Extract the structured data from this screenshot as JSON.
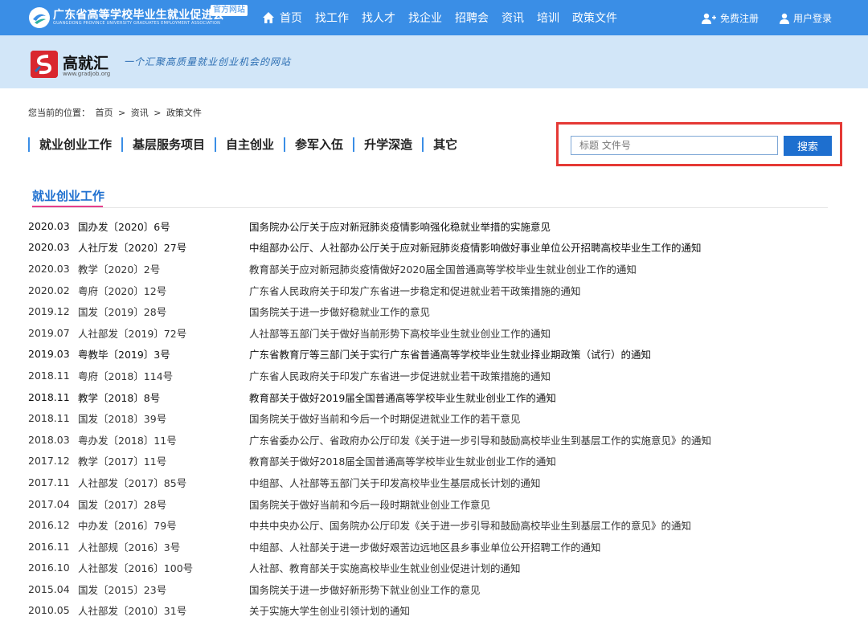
{
  "header": {
    "org_name": "广东省高等学校毕业生就业促进会",
    "org_sub": "GUANGDONG PROVINCE UNIVERSITY GRADUATES EMPLOYMENT ASSOCIATION",
    "official_tag": "官方网站",
    "nav": [
      "首页",
      "找工作",
      "找人才",
      "找企业",
      "招聘会",
      "资讯",
      "培训",
      "政策文件"
    ],
    "register": "免费注册",
    "login": "用户登录"
  },
  "banner": {
    "brand_name": "高就汇",
    "brand_url": "www.gradjob.org",
    "slogan": "一个汇聚高质量就业创业机会的网站"
  },
  "breadcrumb": {
    "prefix": "您当前的位置：",
    "items": [
      "首页",
      "资讯",
      "政策文件"
    ],
    "separator": ">"
  },
  "tabs": [
    "就业创业工作",
    "基层服务项目",
    "自主创业",
    "参军入伍",
    "升学深造",
    "其它"
  ],
  "search": {
    "placeholder": "标题 文件号",
    "button": "搜索"
  },
  "section": {
    "title": "就业创业工作"
  },
  "colors": {
    "primary": "#3a8ee6",
    "accent": "#e63e8c",
    "highlight": "#e53935"
  },
  "policies": [
    {
      "date": "2020.03",
      "doc": "国办发〔2020〕6号",
      "title": "国务院办公厅关于应对新冠肺炎疫情影响强化稳就业举措的实施意见"
    },
    {
      "date": "2020.03",
      "doc": "人社厅发〔2020〕27号",
      "title": "中组部办公厅、人社部办公厅关于应对新冠肺炎疫情影响做好事业单位公开招聘高校毕业生工作的通知"
    },
    {
      "date": "2020.03",
      "doc": "教学〔2020〕2号",
      "title": "教育部关于应对新冠肺炎疫情做好2020届全国普通高等学校毕业生就业创业工作的通知"
    },
    {
      "date": "2020.02",
      "doc": "粤府〔2020〕12号",
      "title": "广东省人民政府关于印发广东省进一步稳定和促进就业若干政策措施的通知"
    },
    {
      "date": "2019.12",
      "doc": "国发〔2019〕28号",
      "title": "国务院关于进一步做好稳就业工作的意见"
    },
    {
      "date": "2019.07",
      "doc": "人社部发〔2019〕72号",
      "title": "人社部等五部门关于做好当前形势下高校毕业生就业创业工作的通知"
    },
    {
      "date": "2019.03",
      "doc": "粤教毕〔2019〕3号",
      "title": "广东省教育厅等三部门关于实行广东省普通高等学校毕业生就业择业期政策（试行）的通知"
    },
    {
      "date": "2018.11",
      "doc": "粤府〔2018〕114号",
      "title": "广东省人民政府关于印发广东省进一步促进就业若干政策措施的通知"
    },
    {
      "date": "2018.11",
      "doc": "教学〔2018〕8号",
      "title": "教育部关于做好2019届全国普通高等学校毕业生就业创业工作的通知"
    },
    {
      "date": "2018.11",
      "doc": "国发〔2018〕39号",
      "title": "国务院关于做好当前和今后一个时期促进就业工作的若干意见"
    },
    {
      "date": "2018.03",
      "doc": "粤办发〔2018〕11号",
      "title": "广东省委办公厅、省政府办公厅印发《关于进一步引导和鼓励高校毕业生到基层工作的实施意见》的通知"
    },
    {
      "date": "2017.12",
      "doc": "教学〔2017〕11号",
      "title": "教育部关于做好2018届全国普通高等学校毕业生就业创业工作的通知"
    },
    {
      "date": "2017.11",
      "doc": "人社部发〔2017〕85号",
      "title": "中组部、人社部等五部门关于印发高校毕业生基层成长计划的通知"
    },
    {
      "date": "2017.04",
      "doc": "国发〔2017〕28号",
      "title": "国务院关于做好当前和今后一段时期就业创业工作意见"
    },
    {
      "date": "2016.12",
      "doc": "中办发〔2016〕79号",
      "title": "中共中央办公厅、国务院办公厅印发《关于进一步引导和鼓励高校毕业生到基层工作的意见》的通知"
    },
    {
      "date": "2016.11",
      "doc": "人社部规〔2016〕3号",
      "title": "中组部、人社部关于进一步做好艰苦边远地区县乡事业单位公开招聘工作的通知"
    },
    {
      "date": "2016.10",
      "doc": "人社部发〔2016〕100号",
      "title": "人社部、教育部关于实施高校毕业生就业创业促进计划的通知"
    },
    {
      "date": "2015.04",
      "doc": "国发〔2015〕23号",
      "title": "国务院关于进一步做好新形势下就业创业工作的意见"
    },
    {
      "date": "2010.05",
      "doc": "人社部发〔2010〕31号",
      "title": "关于实施大学生创业引领计划的通知"
    }
  ]
}
